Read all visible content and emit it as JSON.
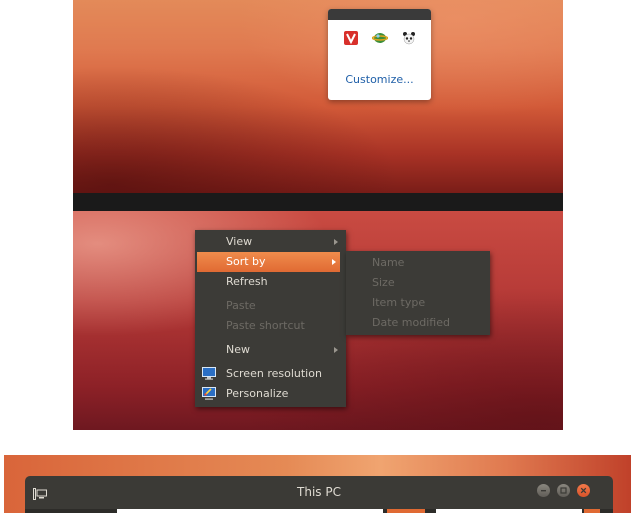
{
  "tray": {
    "icons": [
      "vivaldi-icon",
      "network-globe-icon",
      "panda-icon"
    ],
    "customize_label": "Customize..."
  },
  "context_menu": {
    "items": [
      {
        "label": "View",
        "submenu": true,
        "state": "normal"
      },
      {
        "label": "Sort by",
        "submenu": true,
        "state": "selected"
      },
      {
        "label": "Refresh",
        "submenu": false,
        "state": "normal"
      },
      {
        "label": "Paste",
        "submenu": false,
        "state": "disabled"
      },
      {
        "label": "Paste shortcut",
        "submenu": false,
        "state": "disabled"
      },
      {
        "label": "New",
        "submenu": true,
        "state": "normal"
      },
      {
        "label": "Screen resolution",
        "submenu": false,
        "state": "normal",
        "icon": "monitor-icon"
      },
      {
        "label": "Personalize",
        "submenu": false,
        "state": "normal",
        "icon": "monitor-paint-icon"
      }
    ],
    "sort_submenu": [
      {
        "label": "Name"
      },
      {
        "label": "Size"
      },
      {
        "label": "Item type"
      },
      {
        "label": "Date modified"
      }
    ]
  },
  "window": {
    "title": "This PC",
    "controls": [
      "minimize-icon",
      "maximize-icon",
      "close-icon"
    ]
  },
  "colors": {
    "accent": "#e06a33",
    "menu_bg": "#3c3b37",
    "link": "#1f5fa8"
  }
}
